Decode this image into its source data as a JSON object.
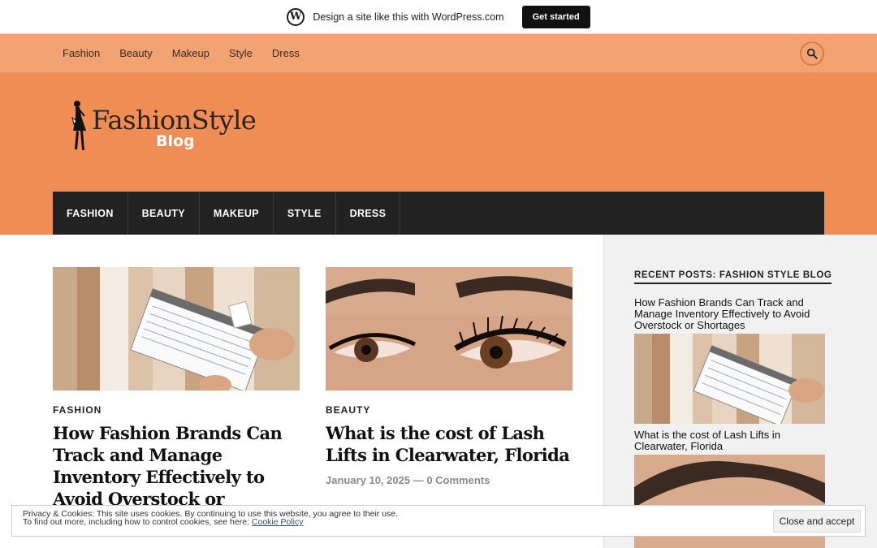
{
  "wp_banner": {
    "text": "Design a site like this with WordPress.com",
    "button": "Get started"
  },
  "top_nav": [
    "Fashion",
    "Beauty",
    "Makeup",
    "Style",
    "Dress"
  ],
  "logo": {
    "brand": "FashionStyle",
    "sub": "Blog"
  },
  "main_nav": [
    "FASHION",
    "BEAUTY",
    "MAKEUP",
    "STYLE",
    "DRESS"
  ],
  "posts": [
    {
      "category": "FASHION",
      "title": "How Fashion Brands Can Track and Manage Inventory Effectively to Avoid Overstock or Shortages"
    },
    {
      "category": "BEAUTY",
      "title": "What is the cost of Lash Lifts in Clearwater, Florida",
      "date": "January 10, 2025",
      "separator": "—",
      "comments": "0 Comments"
    }
  ],
  "sidebar": {
    "widget_title": "RECENT POSTS: FASHION STYLE BLOG",
    "recent": [
      "How Fashion Brands Can Track and Manage Inventory Effectively to Avoid Overstock or Shortages",
      "What is the cost of Lash Lifts in Clearwater, Florida"
    ]
  },
  "cookie": {
    "line1": "Privacy & Cookies: This site uses cookies. By continuing to use this website, you agree to their use.",
    "line2_prefix": "To find out more, including how to control cookies, see here: ",
    "link": "Cookie Policy",
    "button": "Close and accept"
  },
  "colors": {
    "nav_bg": "#f2a373",
    "header_bg": "#ef8d55",
    "menu_bg": "#222222",
    "sidebar_bg": "#f1f1f1"
  },
  "icons": [
    "wordpress-logo-icon",
    "search-icon",
    "fashion-silhouette-logo"
  ]
}
